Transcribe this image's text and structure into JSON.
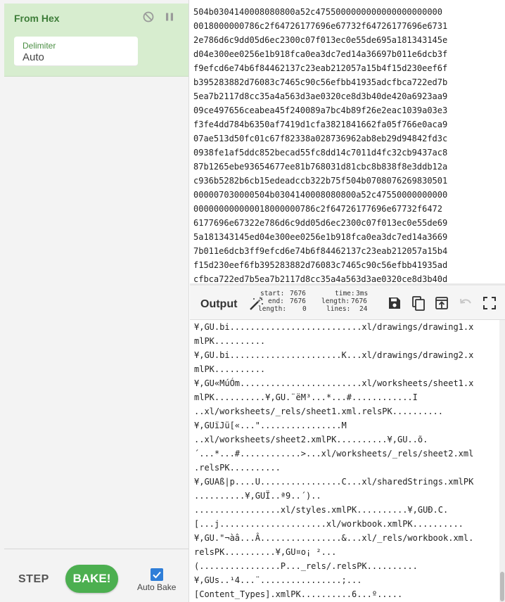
{
  "recipe": {
    "operation_title": "From Hex",
    "icons": {
      "disable": "disable-icon",
      "pause": "pause-icon"
    },
    "delimiter_label": "Delimiter",
    "delimiter_value": "Auto",
    "step_label": "STEP",
    "bake_label": "BAKE!",
    "auto_bake_label": "Auto Bake",
    "auto_bake_checked": true
  },
  "input": {
    "lines": [
      "504b0304140008080800a52c4755000000000000000000000",
      "0018000000786c2f64726177696e67732f64726177696e6731",
      "2e786d6c9dd05d6ec2300c07f013ec0e55de695a181343145e",
      "d04e300ee0256e1b918fca0ea3dc7ed14a36697b011e6dcb3f",
      "f9efcd6e74b6f84462137c23eab212057a15b4f15d230eef6f",
      "b395283882d76083c7465c90c56efbb41935adcfbca722ed7b",
      "5ea7b2117d8cc35a4a563d3ae0320ce8d3b40de420a6923aa9",
      "09ce497656ceabea45f240089a7bc4b89f26e2eac1039a03e3",
      "f3fe4dd784b6350af7419d1cfa3821841662fa05f766e0aca9",
      "07ae513d50fc01c67f82338a028736962ab8eb29d94842fd3c",
      "0938fe1af5ddc852becad55fc8dd14c7011d4fc32cb9437ac8",
      "87b1265ebe93654677ee81b768031d81cbc8b838f8e3ddb12a",
      "c936b5282b6cb15edeadccb322b75f504b0708076269830501",
      "000007030000504b0304140008080800a52c47550000000000",
      "000000000000018000000786c2f64726177696e67732f6472",
      "6177696e67322e786d6c9dd05d6ec2300c07f013ec0e55de69",
      "5a181343145ed04e300ee0256e1b918fca0ea3dc7ed14a3669",
      "7b011e6dcb3ff9efcd6e74b6f84462137c23eab212057a15b4",
      "f15d230eef6fb395283882d76083c7465c90c56efbb41935ad",
      "cfbca722ed7b5ea7b2117d8cc35a4a563d3ae0320ce8d3b40d"
    ]
  },
  "output": {
    "title": "Output",
    "stats": {
      "start_label": "start:",
      "start_value": "7676",
      "end_label": "end:",
      "end_value": "7676",
      "length_label": "length:",
      "length_value": "0",
      "time_label": "time:",
      "time_value": "3ms",
      "out_length_label": "length:",
      "out_length_value": "7676",
      "lines_label": "lines:",
      "lines_value": "24"
    },
    "toolbar_icons": [
      "magic-wand-icon",
      "save-icon",
      "copy-icon",
      "move-to-input-icon",
      "undo-icon",
      "maximize-icon"
    ],
    "lines": [
      "¥,GU.bi..........................xl/drawings/drawing1.x",
      "mlPK..........",
      "¥,GU.bi......................K...xl/drawings/drawing2.x",
      "mlPK..........",
      "¥,GU«MúÓm........................xl/worksheets/sheet1.x",
      "mlPK..........¥,GU.¨ëM³...*...#............I",
      "..xl/worksheets/_rels/sheet1.xml.relsPK..........",
      "¥,GUïJü[«...\"................M",
      "..xl/worksheets/sheet2.xmlPK..........¥,GU..õ.",
      "´...*...#............>...xl/worksheets/_rels/sheet2.xml",
      ".relsPK..........",
      "¥,GUAß|p....U................C...xl/sharedStrings.xmlPK",
      "..........¥,GUÏ..ª9..´)..",
      ".................xl/styles.xmlPK..........¥,GUÐ.C.",
      "[...j.....................xl/workbook.xmlPK..........",
      "¥,GU.\"¬àâ...Â................&...xl/_rels/workbook.xml.",
      "relsPK..........¥,GU¤o¡ ²...",
      "(................P..._rels/.relsPK..........",
      "¥,GUs..¹4...¨................;...",
      "[Content_Types].xmlPK..........6...º....."
    ]
  }
}
